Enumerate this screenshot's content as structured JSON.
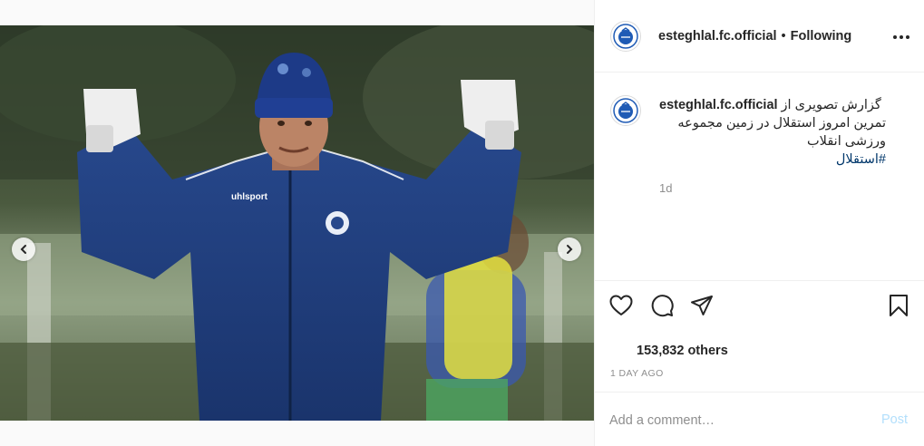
{
  "post": {
    "header": {
      "username": "esteghlal.fc.official",
      "separator": "•",
      "follow_state": "Following",
      "more_icon": "more-horizontal-icon"
    },
    "media": {
      "carousel_count": 10,
      "active_index": 3,
      "prev_icon": "chevron-left-icon",
      "next_icon": "chevron-right-icon"
    },
    "caption": {
      "username": "esteghlal.fc.official",
      "first_line": "گزارش تصویری از",
      "lines": [
        "تمرین امروز استقلال در زمین مجموعه",
        "ورزشی انقلاب"
      ],
      "hashtag": "#استقلال",
      "time": "1d"
    },
    "actions": {
      "like_icon": "heart-icon",
      "comment_icon": "comment-icon",
      "share_icon": "paper-plane-icon",
      "save_icon": "bookmark-icon"
    },
    "likes_text": "153,832 others",
    "date": "1 DAY AGO",
    "comment_box": {
      "placeholder": "Add a comment…",
      "post_label": "Post"
    },
    "colors": {
      "link": "#00376b",
      "post_button_disabled": "#b2dffc",
      "jacket": "#1f3d7a"
    }
  }
}
